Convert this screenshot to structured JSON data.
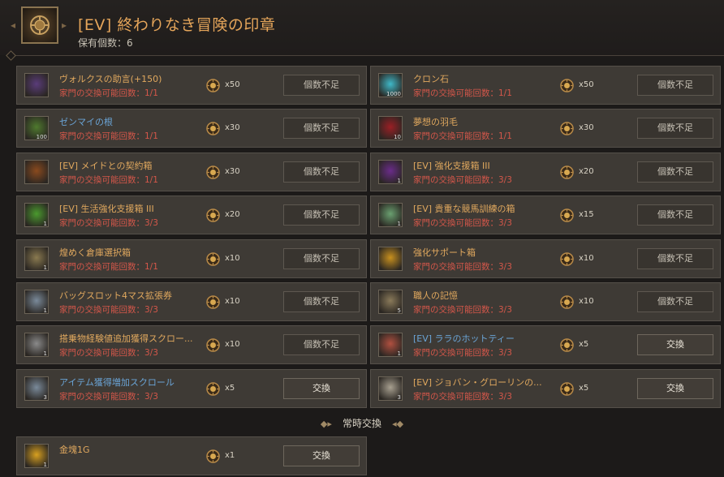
{
  "header": {
    "title": "[EV] 終わりなき冒険の印章",
    "owned": "保有個数：6"
  },
  "limit_prefix": "家門の交換可能回数：",
  "items": [
    {
      "name": "ヴォルクスの助言(+150)",
      "limit": "1/1",
      "cost": "x50",
      "button": "個数不足",
      "color": "gold",
      "qty": "",
      "icon": "book-icon",
      "icon_color": "#5a3c7a"
    },
    {
      "name": "クロン石",
      "limit": "1/1",
      "cost": "x50",
      "button": "個数不足",
      "color": "gold",
      "qty": "1000",
      "icon": "cron-stone-icon",
      "icon_color": "#3fb8c8"
    },
    {
      "name": "ゼンマイの根",
      "limit": "1/1",
      "cost": "x30",
      "button": "個数不足",
      "color": "blue",
      "qty": "100",
      "icon": "herb-icon",
      "icon_color": "#4f7a2e"
    },
    {
      "name": "夢想の羽毛",
      "limit": "1/1",
      "cost": "x30",
      "button": "個数不足",
      "color": "gold",
      "qty": "10",
      "icon": "feather-icon",
      "icon_color": "#9a1f25"
    },
    {
      "name": "[EV] メイドとの契約箱",
      "limit": "1/1",
      "cost": "x30",
      "button": "個数不足",
      "color": "gold",
      "qty": "",
      "icon": "chest-icon",
      "icon_color": "#8a4a1e"
    },
    {
      "name": "[EV] 強化支援箱 III",
      "limit": "3/3",
      "cost": "x20",
      "button": "個数不足",
      "color": "gold",
      "qty": "1",
      "icon": "purple-box-icon",
      "icon_color": "#6a2c8a"
    },
    {
      "name": "[EV] 生活強化支援箱 III",
      "limit": "3/3",
      "cost": "x20",
      "button": "個数不足",
      "color": "gold",
      "qty": "1",
      "icon": "green-box-icon",
      "icon_color": "#4a9a2e"
    },
    {
      "name": "[EV] 貴重な競馬訓練の箱",
      "limit": "3/3",
      "cost": "x15",
      "button": "個数不足",
      "color": "gold",
      "qty": "1",
      "icon": "gift-box-icon",
      "icon_color": "#6aa070"
    },
    {
      "name": "煌めく倉庫選択箱",
      "limit": "1/1",
      "cost": "x10",
      "button": "個数不足",
      "color": "gold",
      "qty": "1",
      "icon": "lantern-icon",
      "icon_color": "#8a7a50"
    },
    {
      "name": "強化サポート箱",
      "limit": "3/3",
      "cost": "x10",
      "button": "個数不足",
      "color": "gold",
      "qty": "",
      "icon": "gold-box-icon",
      "icon_color": "#c8901e"
    },
    {
      "name": "バッグスロット4マス拡張券",
      "limit": "3/3",
      "cost": "x10",
      "button": "個数不足",
      "color": "gold",
      "qty": "1",
      "icon": "bag-ticket-icon",
      "icon_color": "#7a8a9a"
    },
    {
      "name": "職人の記憶",
      "limit": "3/3",
      "cost": "x10",
      "button": "個数不足",
      "color": "gold",
      "qty": "5",
      "icon": "pendant-icon",
      "icon_color": "#8a7a5a"
    },
    {
      "name": "搭乗物経験値追加獲得スクロー...",
      "limit": "3/3",
      "cost": "x10",
      "button": "個数不足",
      "color": "gold",
      "qty": "1",
      "icon": "scroll-icon",
      "icon_color": "#8a8a8a"
    },
    {
      "name": "[EV] ララのホットティー",
      "limit": "3/3",
      "cost": "x5",
      "button": "交換",
      "color": "blue",
      "qty": "1",
      "icon": "tea-cup-icon",
      "icon_color": "#b05040"
    },
    {
      "name": "アイテム獲得増加スクロール",
      "limit": "3/3",
      "cost": "x5",
      "button": "交換",
      "color": "blue",
      "qty": "3",
      "icon": "scroll-icon",
      "icon_color": "#7a8a9a"
    },
    {
      "name": "[EV] ジョバン・グローリンの...",
      "limit": "3/3",
      "cost": "x5",
      "button": "交換",
      "color": "gold",
      "qty": "3",
      "icon": "letter-icon",
      "icon_color": "#a8a090"
    }
  ],
  "permanent": {
    "label": "常時交換",
    "items": [
      {
        "name": "金塊1G",
        "limit": "",
        "cost": "x1",
        "button": "交換",
        "color": "gold",
        "qty": "1",
        "icon": "gold-bar-icon",
        "icon_color": "#d8a020"
      }
    ]
  }
}
